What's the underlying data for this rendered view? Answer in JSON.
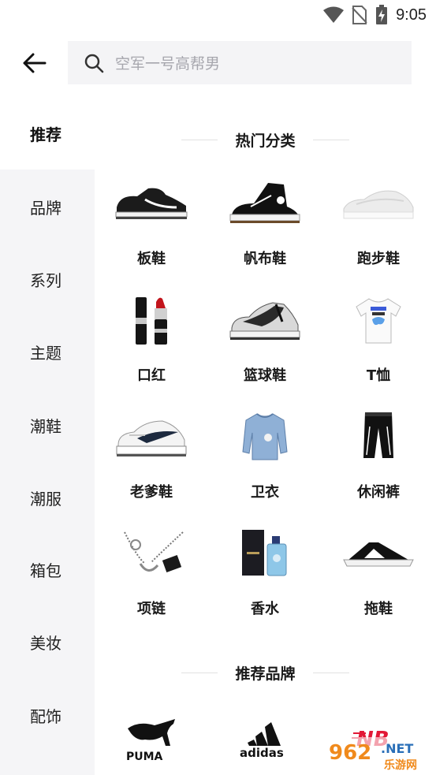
{
  "status_bar": {
    "time": "9:05"
  },
  "header": {
    "search_placeholder": "空军一号高帮男"
  },
  "sidebar": {
    "items": [
      {
        "label": "推荐"
      },
      {
        "label": "品牌"
      },
      {
        "label": "系列"
      },
      {
        "label": "主题"
      },
      {
        "label": "潮鞋"
      },
      {
        "label": "潮服"
      },
      {
        "label": "箱包"
      },
      {
        "label": "美妆"
      },
      {
        "label": "配饰"
      }
    ]
  },
  "main": {
    "hot_section_title": "热门分类",
    "categories": [
      {
        "label": "板鞋",
        "icon": "skate-shoe-icon"
      },
      {
        "label": "帆布鞋",
        "icon": "canvas-shoe-icon"
      },
      {
        "label": "跑步鞋",
        "icon": "running-shoe-icon"
      },
      {
        "label": "口红",
        "icon": "lipstick-icon"
      },
      {
        "label": "篮球鞋",
        "icon": "basketball-shoe-icon"
      },
      {
        "label": "T恤",
        "icon": "tshirt-icon"
      },
      {
        "label": "老爹鞋",
        "icon": "dad-shoe-icon"
      },
      {
        "label": "卫衣",
        "icon": "sweatshirt-icon"
      },
      {
        "label": "休闲裤",
        "icon": "pants-icon"
      },
      {
        "label": "项链",
        "icon": "necklace-icon"
      },
      {
        "label": "香水",
        "icon": "perfume-icon"
      },
      {
        "label": "拖鞋",
        "icon": "slipper-icon"
      }
    ],
    "brand_section_title": "推荐品牌",
    "brands": [
      {
        "name": "PUMA",
        "icon": "puma-logo"
      },
      {
        "name": "adidas",
        "icon": "adidas-logo"
      },
      {
        "name": "New Balance",
        "icon": "new-balance-logo"
      }
    ]
  },
  "watermark": {
    "number": "962",
    "suffix": ".NET",
    "text": "乐游网"
  },
  "colors": {
    "sidebar_bg": "#f5f5f7",
    "search_bg": "#f4f4f6",
    "placeholder": "#a6a6ad",
    "nb_red": "#e21836"
  }
}
